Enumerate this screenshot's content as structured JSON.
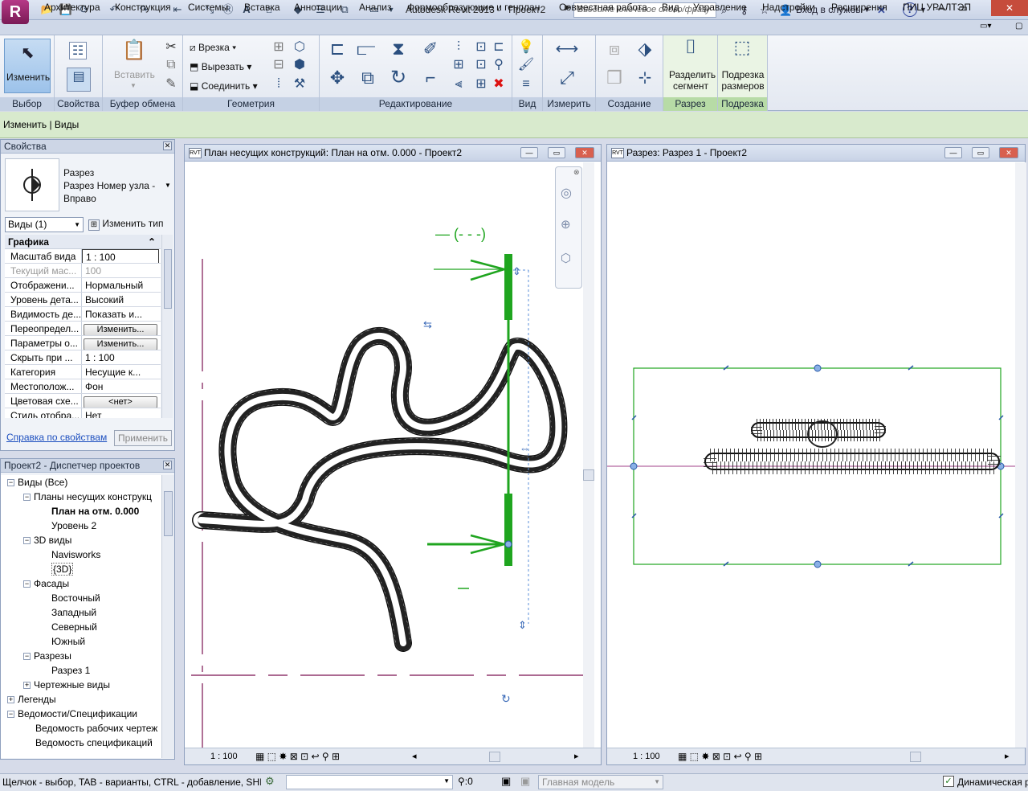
{
  "title_bar": {
    "app_title": "Autodesk Revit 2013 -",
    "project": "Проект2",
    "search_placeholder": "Введите ключевое слово/фразу",
    "login": "Вход в службы",
    "help": "?"
  },
  "menu": {
    "tabs": [
      "Архитектура",
      "Конструкция",
      "Системы",
      "Вставка",
      "Аннотации",
      "Анализ",
      "Формообразующие и генплан",
      "Совместная работа",
      "Вид",
      "Управление",
      "Надстройки",
      "Расширения",
      "ПИЦ УРАЛТЭП"
    ],
    "active": "Изменить"
  },
  "ribbon": {
    "select": {
      "button": "Изменить",
      "label": "Выбор"
    },
    "properties": {
      "label": "Свойства"
    },
    "clipboard": {
      "paste": "Вставить",
      "label": "Буфер обмена"
    },
    "geometry": {
      "cut": "Врезка",
      "cut_out": "Вырезать",
      "join": "Соединить",
      "label": "Геометрия"
    },
    "modify": {
      "label": "Редактирование"
    },
    "view": {
      "label": "Вид"
    },
    "measure": {
      "label": "Измерить"
    },
    "create": {
      "label": "Создание"
    },
    "section": {
      "button1": "Разделить",
      "button2": "сегмент",
      "label": "Разрез"
    },
    "crop": {
      "button1": "Подрезка",
      "button2": "размеров",
      "label": "Подрезка"
    }
  },
  "context": {
    "text": "Изменить | Виды"
  },
  "properties": {
    "title": "Свойства",
    "type_line1": "Разрез",
    "type_line2": "Разрез Номер узла -",
    "type_line3": "Вправо",
    "selector": "Виды (1)",
    "edit_type": "Изменить тип",
    "group": "Графика",
    "rows": [
      {
        "name": "Масштаб вида",
        "value": "1 : 100"
      },
      {
        "name": "Текущий мас...",
        "value": "100"
      },
      {
        "name": "Отображени...",
        "value": "Нормальный"
      },
      {
        "name": "Уровень дета...",
        "value": "Высокий"
      },
      {
        "name": "Видимость де...",
        "value": "Показать и..."
      },
      {
        "name": "Переопредел...",
        "value": "Изменить..."
      },
      {
        "name": "Параметры о...",
        "value": "Изменить..."
      },
      {
        "name": "Скрыть при ...",
        "value": "1 : 100"
      },
      {
        "name": "Категория",
        "value": "Несущие к..."
      },
      {
        "name": "Местополож...",
        "value": "Фон"
      },
      {
        "name": "Цветовая схе...",
        "value": "<нет>"
      },
      {
        "name": "Стиль отобра...",
        "value": "Нет"
      }
    ],
    "help_link": "Справка по свойствам",
    "apply": "Применить"
  },
  "browser": {
    "title": "Проект2 - Диспетчер проектов",
    "nodes": [
      {
        "label": "Виды (Все)",
        "level": 0,
        "exp": "-"
      },
      {
        "label": "Планы несущих конструкц",
        "level": 1,
        "exp": "-"
      },
      {
        "label": "План на отм. 0.000",
        "level": 2,
        "exp": "",
        "bold": true
      },
      {
        "label": "Уровень 2",
        "level": 2,
        "exp": ""
      },
      {
        "label": "3D виды",
        "level": 1,
        "exp": "-"
      },
      {
        "label": "Navisworks",
        "level": 2,
        "exp": ""
      },
      {
        "label": "{3D}",
        "level": 2,
        "exp": ""
      },
      {
        "label": "Фасады",
        "level": 1,
        "exp": "-"
      },
      {
        "label": "Восточный",
        "level": 2,
        "exp": ""
      },
      {
        "label": "Западный",
        "level": 2,
        "exp": ""
      },
      {
        "label": "Северный",
        "level": 2,
        "exp": ""
      },
      {
        "label": "Южный",
        "level": 2,
        "exp": ""
      },
      {
        "label": "Разрезы",
        "level": 1,
        "exp": "-"
      },
      {
        "label": "Разрез 1",
        "level": 2,
        "exp": ""
      },
      {
        "label": "Чертежные виды",
        "level": 1,
        "exp": "+"
      },
      {
        "label": "Легенды",
        "level": 0,
        "exp": "+"
      },
      {
        "label": "Ведомости/Спецификации",
        "level": 0,
        "exp": "-"
      },
      {
        "label": "Ведомость рабочих чертеж",
        "level": 1,
        "exp": ""
      },
      {
        "label": "Ведомость спецификаций",
        "level": 1,
        "exp": ""
      }
    ]
  },
  "view_plan": {
    "title": "План несущих конструкций: План на отм. 0.000 - Проект2",
    "scale": "1 : 100"
  },
  "view_section": {
    "title": "Разрез: Разрез 1 - Проект2",
    "scale": "1 : 100"
  },
  "status": {
    "text": "Щелчок - выбор, TAB - варианты, CTRL - добавление, SHIF",
    "zero": ":0",
    "model": "Главная модель",
    "dynamic": "Динамическая р"
  }
}
